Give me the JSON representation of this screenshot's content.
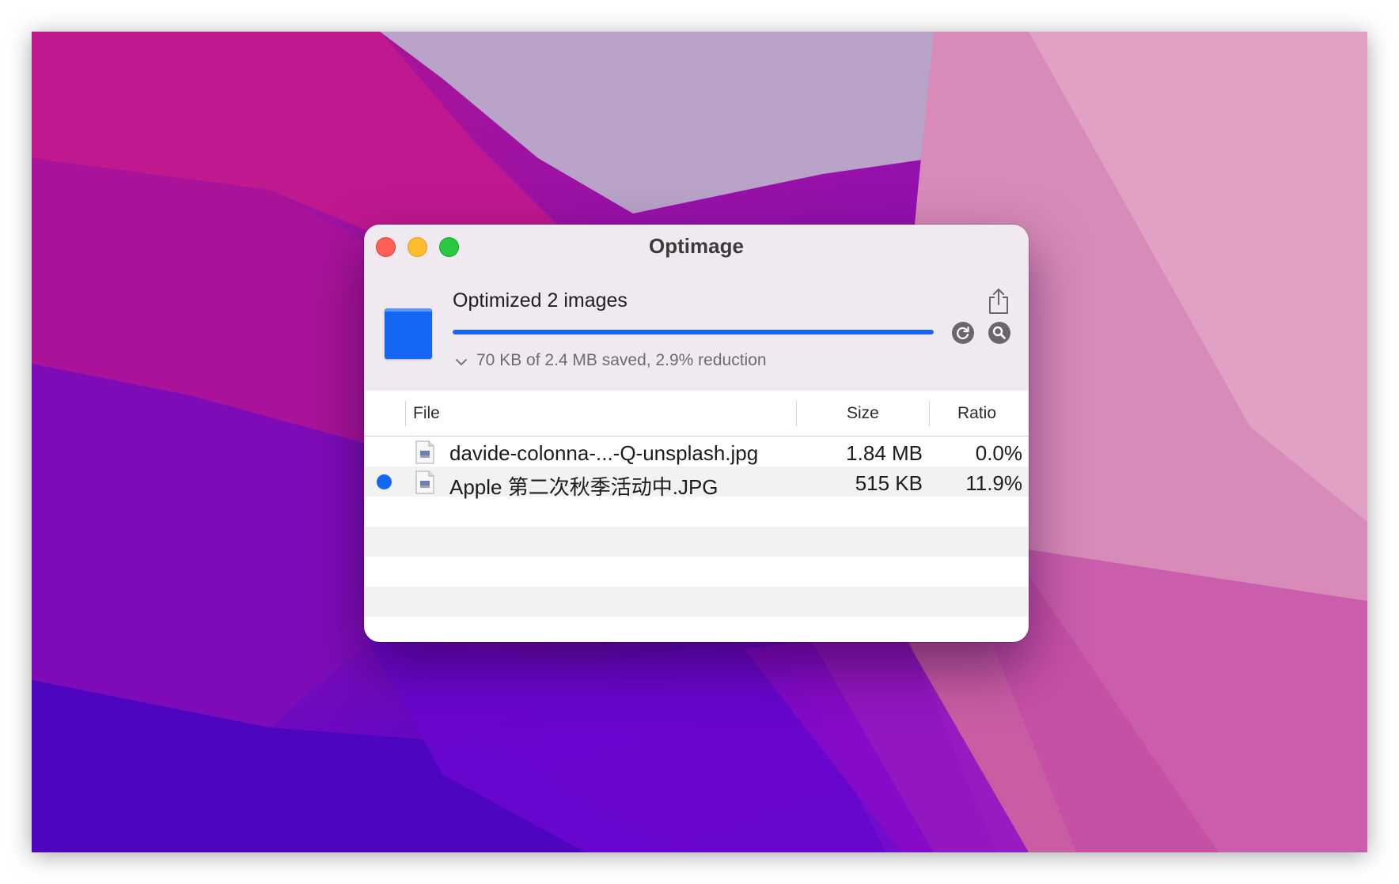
{
  "window": {
    "title": "Optimage"
  },
  "status": {
    "heading": "Optimized 2 images",
    "progress_fraction": 1.0,
    "summary": "70 KB of 2.4 MB saved, 2.9% reduction"
  },
  "icons": {
    "share": "share-icon",
    "refresh": "refresh-icon",
    "inspect": "magnifier-icon",
    "disclosure": "chevron-down-icon",
    "document": "document-icon"
  },
  "table": {
    "columns": [
      "File",
      "Size",
      "Ratio"
    ],
    "rows": [
      {
        "name": "davide-colonna-...-Q-unsplash.jpg",
        "size": "1.84 MB",
        "ratio": "0.0%",
        "marked": false
      },
      {
        "name": "Apple 第二次秋季活动中.JPG",
        "size": "515 KB",
        "ratio": "11.9%",
        "marked": true
      }
    ]
  },
  "colors": {
    "accent": "#1466f5",
    "close": "#fe5f57",
    "minimize": "#febc2e",
    "zoom": "#28c840"
  }
}
